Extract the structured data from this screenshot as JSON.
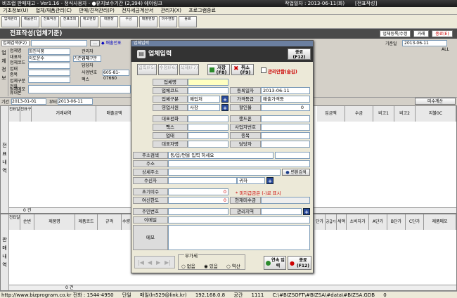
{
  "window": {
    "title": "비즈랩 판매재고 - Ver1.16 - 정식사용자 - ●유지보수기간 (2,394) 에이링크",
    "workdate": "작업일자 : 2013-06-11(화)",
    "screen_label": "[전표작성]"
  },
  "menu": [
    "기초정보(U)",
    "업체/재품관리(C)",
    "판매/견적관리(P)",
    "전자세금계산서",
    "관리자(X)",
    "프로그램종료"
  ],
  "toolbar": [
    "업체관리",
    "제품관리",
    "전표작성",
    "전표조회",
    "재고현황",
    "매출장",
    "수금",
    "매출현황",
    "미수현황",
    "종료"
  ],
  "section_title": "전표작성(업체기준)",
  "top_right": {
    "btn1": "업체등록/수정(E)",
    "btn2": "거래",
    "btn3": "종료(E)",
    "date_label": "기준일",
    "date": "2013-06-11",
    "all": "ALL"
  },
  "company": {
    "label_search": "업체검색(F2)",
    "fields": [
      "업체명",
      "대표자",
      "업체코드",
      "업태",
      "종목",
      "업체구분",
      "전화",
      "휴대폰",
      "업체메모"
    ],
    "right_fields": [
      "관리자",
      "업체구분",
      "담당자",
      "사업번호",
      "팩스"
    ],
    "sample": [
      "화진식품",
      "이도운수",
      "기존업체",
      "사업번호",
      "605-81-07660"
    ]
  },
  "period": {
    "label": "기간",
    "start": "2013-01-01",
    "end": "2013-06-11",
    "to": "부터"
  },
  "upper_grid": {
    "side": "전표내역",
    "headers": [
      "전표일자",
      "전표구분",
      "거래내역",
      "매출금액",
      "입금액",
      "수금",
      "비고1",
      "비고2",
      "지불0C"
    ],
    "total": "0 건",
    "button": "미수계산"
  },
  "lower_grid": {
    "side": "판매내역",
    "headers": [
      "전표일자",
      "순번",
      "제품명",
      "제품코드",
      "규격",
      "수량",
      "단가",
      "공급가",
      "세액",
      "소비자가",
      "A단가",
      "B단가",
      "C단가",
      "제품메모"
    ],
    "total": "0 건"
  },
  "status": [
    "http://www.bizprogram.co.kr 전화 : 1544-4950",
    "단일",
    "매일(ln529@link.kr)",
    "192.168.0.8",
    "공간",
    "1111",
    "C:\\#BIZSOFT\\#BIZSA\\#data\\#BIZSA.GDB",
    "0"
  ],
  "dialog": {
    "window_title": "업체입력",
    "heading": "업체입력",
    "close": "종료 (F12)",
    "buttons": {
      "add": "입력(F5)",
      "edit": "수정(F6)",
      "delete": "삭제(F7)",
      "save": "저장(F8)",
      "cancel": "취소(F9)"
    },
    "manage_check": "관리안함(숨김)",
    "labels": {
      "name": "업체명",
      "code": "업체코드",
      "reg_date": "등록일자",
      "category": "업체구분",
      "price_grade": "가격등급",
      "sales_rep": "영업사원",
      "discount": "할인율",
      "ceo_phone": "대표전화",
      "mobile": "핸드폰",
      "fax": "팩스",
      "biz_no": "사업자번호",
      "biz_type": "업태",
      "item": "종목",
      "ceo": "대표자명",
      "manager": "담당자",
      "addr_search": "주소검색",
      "addr": "주소",
      "addr_detail": "상세주소",
      "receiver": "수신자",
      "init_unpaid": "초기미수",
      "credit_limit": "여신한도",
      "cur_unpaid": "현재미수금",
      "resident_no": "주민번호",
      "region": "관리지역",
      "email": "이메일",
      "memo": "메모"
    },
    "values": {
      "reg_date": "2013-06-11",
      "category": "매입처",
      "price_grade": "매출가격등",
      "sales_rep": "사장",
      "discount": "0",
      "addr_search": "동/읍/면을 입력 하세요",
      "receiver": "귀하",
      "init_unpaid": "0",
      "credit_limit": "0",
      "unpaid_note": "* 미지급금은 (-)로 표시"
    },
    "addr_convert": "변환검색",
    "tax": {
      "label": "부가세",
      "opts": [
        "없음",
        "있음",
        "역산"
      ]
    },
    "continue_btn": "연속 입력",
    "close2": "종료 (F12)"
  },
  "colors": {
    "accent_red": "#c0392b",
    "dark": "#333333",
    "field_yellow": "#ffffc0"
  }
}
